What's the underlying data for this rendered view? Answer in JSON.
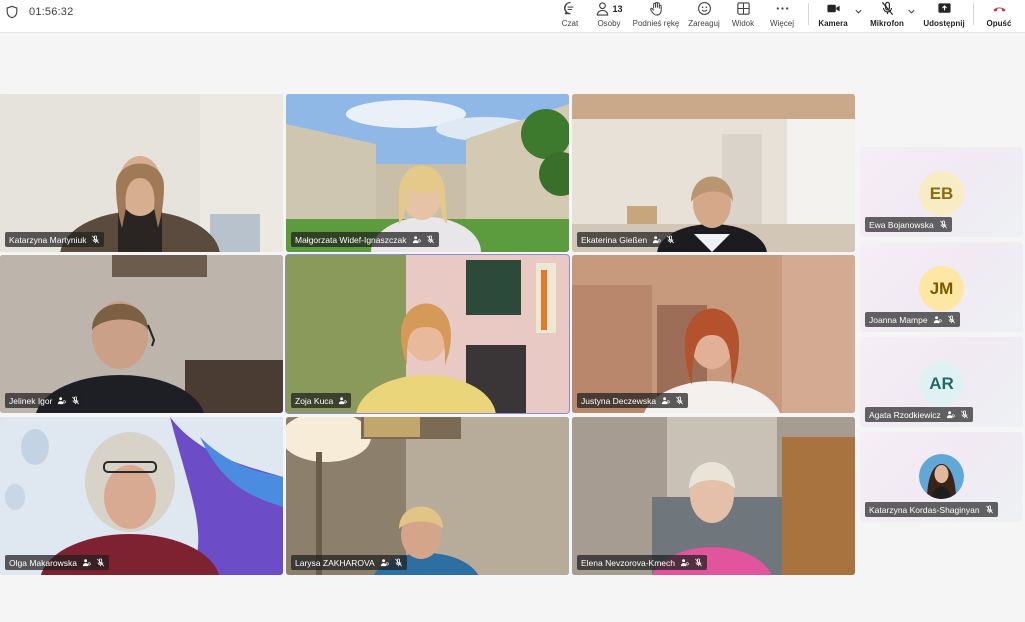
{
  "meeting": {
    "timer": "01:56:32"
  },
  "toolbar": {
    "chat": "Czat",
    "people": "Osoby",
    "people_count": "13",
    "raise_hand": "Podnieś rękę",
    "react": "Zareaguj",
    "view": "Widok",
    "more": "Więcej",
    "camera": "Kamera",
    "mic": "Mikrofon",
    "share": "Udostępnij",
    "leave": "Opuść",
    "leave_color": "#c4314b"
  },
  "participants": [
    {
      "name": "Katarzyna Martyniuk"
    },
    {
      "name": "Małgorzata Widef-Ignaszczak"
    },
    {
      "name": "Ekaterina Gießen"
    },
    {
      "name": "Jelinek Igor"
    },
    {
      "name": "Zoja Kuca"
    },
    {
      "name": "Justyna Deczewska"
    },
    {
      "name": "Olga Makarowska"
    },
    {
      "name": "Larysa ZAKHAROVA"
    },
    {
      "name": "Elena Nevzorova-Kmech"
    }
  ],
  "roster": [
    {
      "initials": "EB",
      "name": "Ewa Bojanowska",
      "avatar_bg": "#f7ecc4",
      "avatar_fg": "#8a6b12"
    },
    {
      "initials": "JM",
      "name": "Joanna Mampe",
      "avatar_bg": "#fde7a3",
      "avatar_fg": "#7a5a00"
    },
    {
      "initials": "AR",
      "name": "Agata Rzodkiewicz",
      "avatar_bg": "#dff2f1",
      "avatar_fg": "#1f6b66"
    },
    {
      "initials": "",
      "name": "Katarzyna Kordas-Shaginyan"
    }
  ]
}
